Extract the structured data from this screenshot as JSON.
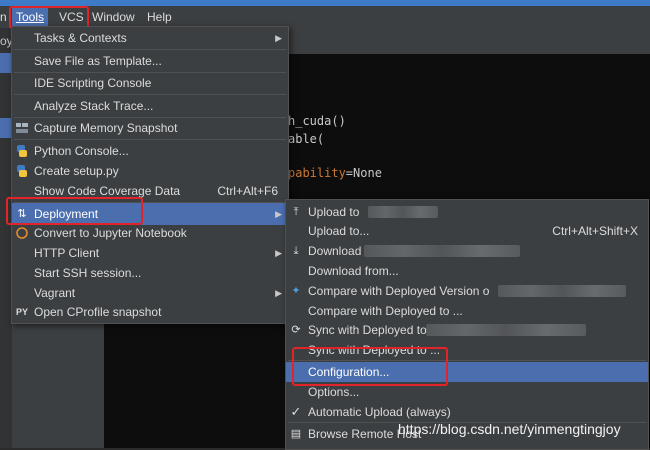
{
  "menubar": {
    "items": [
      "n",
      "Tools",
      "VCS",
      "Window",
      "Help"
    ]
  },
  "left_panel": {
    "labels": [
      "oy"
    ]
  },
  "code": {
    "line1": "h_cuda()",
    "line2": "able(",
    "line3_kw": "pability",
    "line3_rest": "=None"
  },
  "tools_menu": {
    "items": [
      {
        "label": "Tasks & Contexts",
        "arrow": "▶"
      },
      {
        "label": "Save File as Template..."
      },
      {
        "label": "IDE Scripting Console"
      },
      {
        "label": "Analyze Stack Trace..."
      },
      {
        "label": "Capture Memory Snapshot"
      },
      {
        "label": "Python Console..."
      },
      {
        "label": "Create setup.py"
      },
      {
        "label": "Show Code Coverage Data",
        "shortcut": "Ctrl+Alt+F6"
      },
      {
        "label": "Deployment",
        "arrow": "▶"
      },
      {
        "label": "Convert to Jupyter Notebook"
      },
      {
        "label": "HTTP Client",
        "arrow": "▶"
      },
      {
        "label": "Start SSH session..."
      },
      {
        "label": "Vagrant",
        "arrow": "▶"
      },
      {
        "label": "Open CProfile snapshot"
      }
    ]
  },
  "deployment_menu": {
    "items": [
      {
        "label": "Upload to"
      },
      {
        "label": "Upload to...",
        "shortcut": "Ctrl+Alt+Shift+X"
      },
      {
        "label": "Download"
      },
      {
        "label": "Download from..."
      },
      {
        "label": "Compare with Deployed Version o"
      },
      {
        "label": "Compare with Deployed to ..."
      },
      {
        "label": "Sync with Deployed to"
      },
      {
        "label": "Sync with Deployed to ..."
      },
      {
        "label": "Configuration..."
      },
      {
        "label": "Options..."
      },
      {
        "label": "Automatic Upload (always)"
      },
      {
        "label": "Browse Remote Host"
      }
    ]
  },
  "watermark": "https://blog.csdn.net/yinmengtingjoy",
  "colors": {
    "accent": "#4b6eaf",
    "highlight_box": "#e0242a"
  }
}
